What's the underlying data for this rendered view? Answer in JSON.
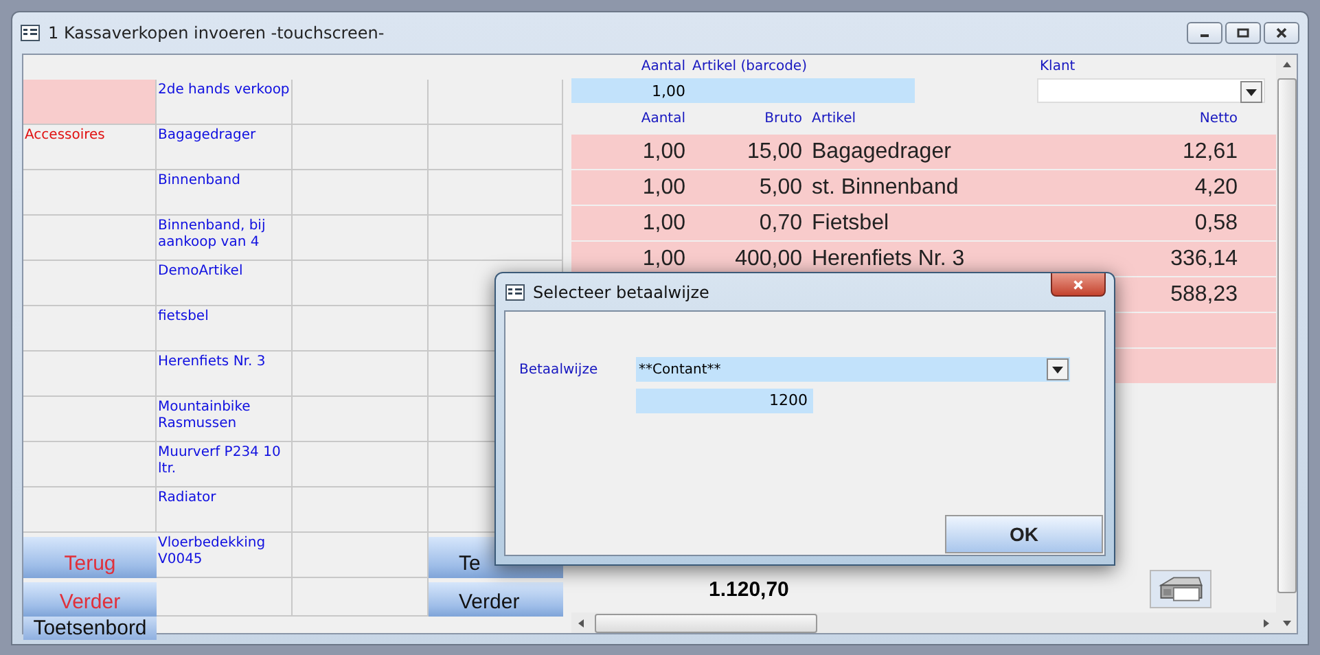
{
  "window": {
    "title": "1 Kassaverkopen invoeren -touchscreen-"
  },
  "entry": {
    "quantity_label": "Aantal",
    "article_label": "Artikel (barcode)",
    "quantity": "1,00",
    "customer_label": "Klant"
  },
  "grid": {
    "rows": [
      {
        "category_selected": true,
        "article": "2de hands verkoop"
      },
      {
        "category": "Accessoires",
        "category_selected": false,
        "article": "Bagagedrager"
      },
      {
        "category_selected": false,
        "article": "Binnenband"
      },
      {
        "category_selected": false,
        "article": "Binnenband, bij aankoop van 4"
      },
      {
        "category_selected": false,
        "article": "DemoArtikel"
      },
      {
        "category_selected": false,
        "article": "fietsbel"
      },
      {
        "category_selected": false,
        "article": "Herenfiets Nr. 3"
      },
      {
        "category_selected": false,
        "article": "Mountainbike Rasmussen"
      },
      {
        "category_selected": false,
        "article": "Muurverf P234 10 ltr."
      },
      {
        "category_selected": false,
        "article": "Radiator"
      },
      {
        "article": "Vloerbedekking V0045"
      },
      {}
    ]
  },
  "left_buttons": [
    {
      "label": "Terug"
    },
    {
      "label": "Verder"
    }
  ],
  "keyboard_button": "Toetsenbord",
  "right_buttons": [
    {
      "label": "Te"
    },
    {
      "label": "Verder"
    }
  ],
  "lines": {
    "columns": [
      "Aantal",
      "Bruto",
      "Artikel",
      "Netto"
    ],
    "rows": [
      {
        "quantity": "1,00",
        "gross": "15,00",
        "article": "Bagagedrager",
        "net": "12,61"
      },
      {
        "quantity": "1,00",
        "gross": "5,00",
        "article": "st. Binnenband",
        "net": "4,20"
      },
      {
        "quantity": "1,00",
        "gross": "0,70",
        "article": "Fietsbel",
        "net": "0,58"
      },
      {
        "quantity": "1,00",
        "gross": "400,00",
        "article": "Herenfiets Nr. 3",
        "net": "336,14"
      },
      {
        "net": "588,23"
      },
      {},
      {}
    ]
  },
  "total": "1.120,70",
  "dialog": {
    "title": "Selecteer betaalwijze",
    "payment_label": "Betaalwijze",
    "payment_method": "**Contant**",
    "amount": "1200",
    "ok": "OK"
  }
}
